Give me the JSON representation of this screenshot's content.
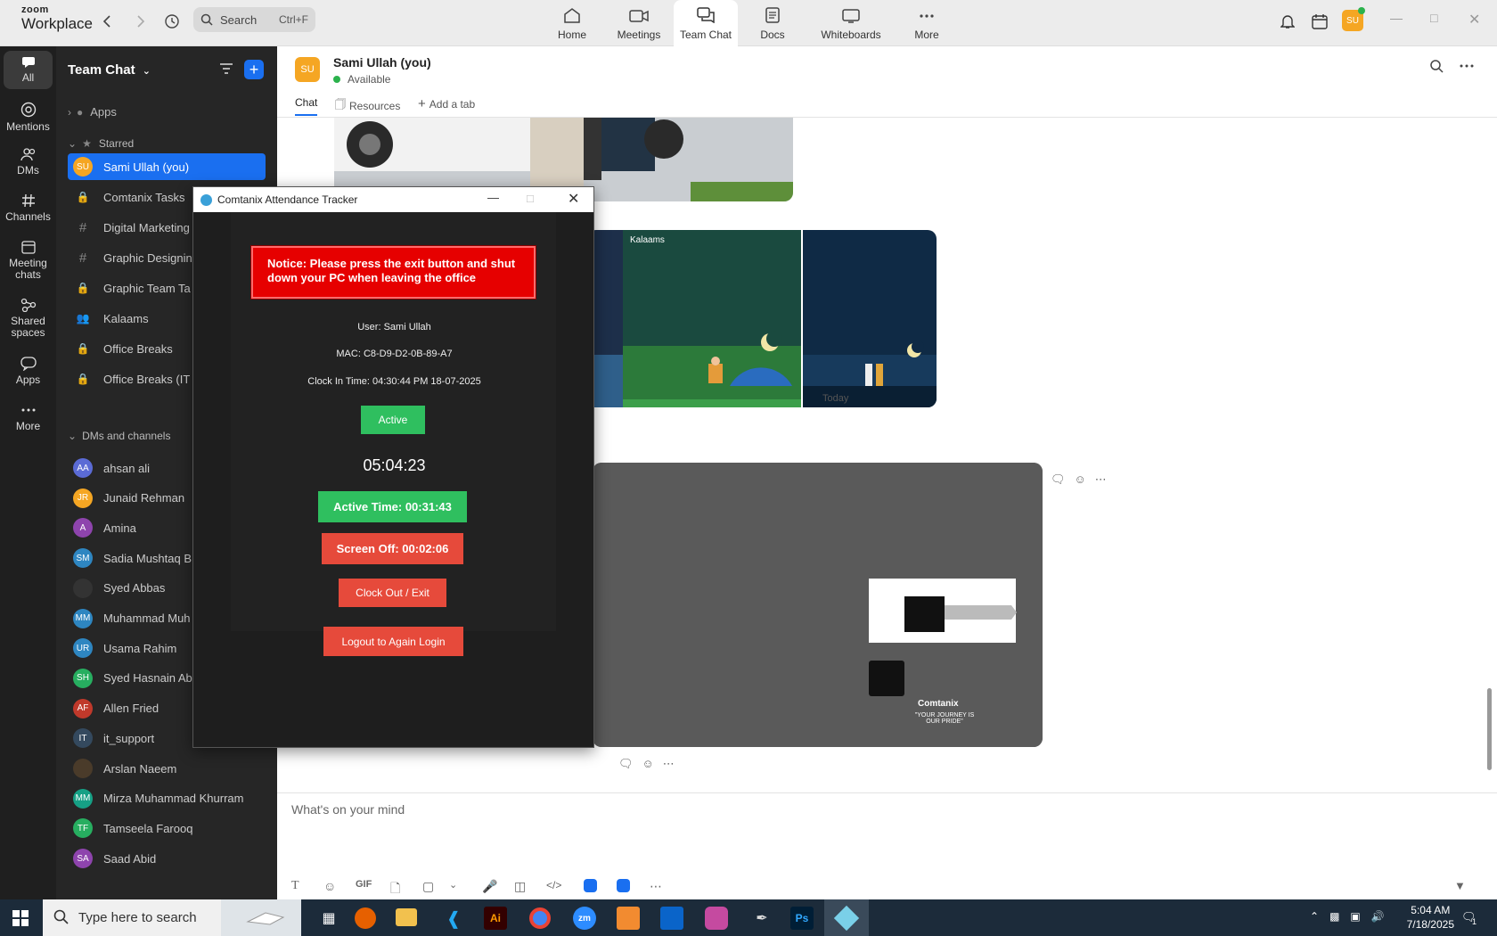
{
  "app": {
    "logo_top": "zoom",
    "logo_bottom": "Workplace",
    "search_placeholder": "Search",
    "search_shortcut": "Ctrl+F",
    "avatar": "SU"
  },
  "top_nav": [
    {
      "label": "Home",
      "icon": "home-icon"
    },
    {
      "label": "Meetings",
      "icon": "video-icon"
    },
    {
      "label": "Team Chat",
      "icon": "chat-icon",
      "active": true
    },
    {
      "label": "Docs",
      "icon": "doc-icon"
    },
    {
      "label": "Whiteboards",
      "icon": "whiteboard-icon"
    },
    {
      "label": "More",
      "icon": "more-icon"
    }
  ],
  "rail": [
    {
      "label": "All",
      "active": true
    },
    {
      "label": "Mentions"
    },
    {
      "label": "DMs"
    },
    {
      "label": "Channels"
    },
    {
      "label": "Meeting chats"
    },
    {
      "label": "Shared spaces"
    },
    {
      "label": "Apps"
    },
    {
      "label": "More"
    }
  ],
  "sidebar": {
    "title": "Team Chat",
    "apps_label": "Apps",
    "starred_label": "Starred",
    "starred": [
      {
        "label": "Sami Ullah (you)",
        "kind": "avatar",
        "initials": "SU",
        "color": "#f5a623",
        "selected": true
      },
      {
        "label": "Comtanix Tasks",
        "kind": "lock"
      },
      {
        "label": "Digital Marketing",
        "kind": "hash"
      },
      {
        "label": "Graphic Designin",
        "kind": "hash"
      },
      {
        "label": "Graphic Team Ta",
        "kind": "lock"
      },
      {
        "label": "Kalaams",
        "kind": "group"
      },
      {
        "label": "Office Breaks",
        "kind": "lock"
      },
      {
        "label": "Office Breaks (IT",
        "kind": "lock"
      }
    ],
    "dm_section_label": "DMs and channels",
    "dms": [
      {
        "label": "ahsan ali",
        "initials": "AA",
        "color": "#5b6bd5"
      },
      {
        "label": "Junaid Rehman",
        "initials": "JR",
        "color": "#f5a623"
      },
      {
        "label": "Amina",
        "initials": "A",
        "color": "#8e44ad"
      },
      {
        "label": "Sadia Mushtaq B",
        "initials": "SM",
        "color": "#2e86c1"
      },
      {
        "label": "Syed Abbas",
        "initials": "",
        "color": "#333333"
      },
      {
        "label": "Muhammad Muh",
        "initials": "MM",
        "color": "#2e86c1"
      },
      {
        "label": "Usama Rahim",
        "initials": "UR",
        "color": "#2e86c1"
      },
      {
        "label": "Syed Hasnain Ab",
        "initials": "SH",
        "color": "#27ae60"
      },
      {
        "label": "Allen Fried",
        "initials": "AF",
        "color": "#c0392b"
      },
      {
        "label": "it_support",
        "initials": "IT",
        "color": "#34495e"
      },
      {
        "label": "Arslan Naeem",
        "initials": "",
        "color": "#4a3b2a"
      },
      {
        "label": "Mirza Muhammad Khurram",
        "initials": "MM",
        "color": "#16a085"
      },
      {
        "label": "Tamseela Farooq",
        "initials": "TF",
        "color": "#27ae60"
      },
      {
        "label": "Saad Abid",
        "initials": "SA",
        "color": "#8e44ad"
      }
    ]
  },
  "chat": {
    "name": "Sami Ullah (you)",
    "initials": "SU",
    "status": "Available",
    "tabs": [
      "Chat",
      "Resources",
      "Add a tab"
    ],
    "date_divider": "Today",
    "compose_placeholder": "What's on your mind",
    "gif_label": "GIF"
  },
  "attendance": {
    "title": "Comtanix Attendance Tracker",
    "notice": "Notice: Please press the exit button and shut down your PC when leaving the office",
    "user": "User: Sami Ullah",
    "mac": "MAC: C8-D9-D2-0B-89-A7",
    "clock_in": "Clock In Time: 04:30:44 PM 18-07-2025",
    "status": "Active",
    "timer": "05:04:23",
    "active_time": "Active Time: 00:31:43",
    "screen_off": "Screen Off: 00:02:06",
    "clock_out": "Clock Out / Exit",
    "logout": "Logout to Again Login"
  },
  "posters": {
    "brand": "Comtanix",
    "tagline": "\"YOUR JOURNEY IS OUR PRIDE\"",
    "kalaams": "Kalaams"
  },
  "taskbar": {
    "search_placeholder": "Type here to search",
    "time": "5:04 AM",
    "date": "7/18/2025",
    "apps": [
      "Ai",
      "zm",
      "Ps"
    ],
    "notif_count": "1"
  },
  "colors": {
    "accent": "#1a6ff0",
    "notice_red": "#e60000",
    "green": "#2fbf5f",
    "red_button": "#e64a3b"
  }
}
